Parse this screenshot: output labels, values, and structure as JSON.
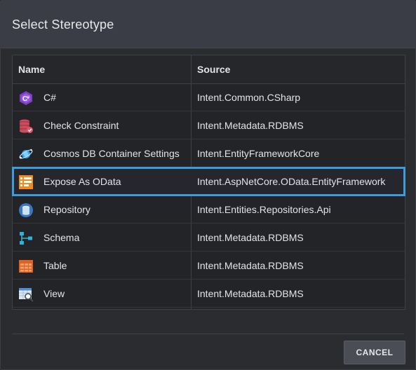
{
  "dialog": {
    "title": "Select Stereotype",
    "cancel_label": "CANCEL"
  },
  "table": {
    "headers": {
      "name": "Name",
      "source": "Source"
    },
    "rows": [
      {
        "name": "C#",
        "source": "Intent.Common.CSharp",
        "icon": "csharp-icon"
      },
      {
        "name": "Check Constraint",
        "source": "Intent.Metadata.RDBMS",
        "icon": "database-check-icon"
      },
      {
        "name": "Cosmos DB Container Settings",
        "source": "Intent.EntityFrameworkCore",
        "icon": "cosmos-db-icon"
      },
      {
        "name": "Expose As OData",
        "source": "Intent.AspNetCore.OData.EntityFramework",
        "icon": "odata-icon"
      },
      {
        "name": "Repository",
        "source": "Intent.Entities.Repositories.Api",
        "icon": "repository-icon"
      },
      {
        "name": "Schema",
        "source": "Intent.Metadata.RDBMS",
        "icon": "schema-icon"
      },
      {
        "name": "Table",
        "source": "Intent.Metadata.RDBMS",
        "icon": "table-icon"
      },
      {
        "name": "View",
        "source": "Intent.Metadata.RDBMS",
        "icon": "view-icon"
      }
    ],
    "selected_row": "Expose As OData"
  },
  "colors": {
    "selection": "#3d9ddc",
    "header_bg": "#3a3d46",
    "dialog_bg": "#2b2c30"
  }
}
